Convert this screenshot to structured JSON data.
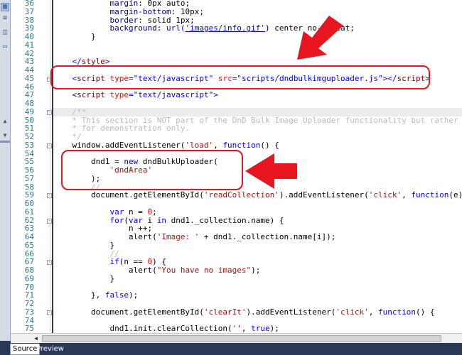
{
  "toolbar": {
    "icons": [
      "design-icon",
      "code-icon",
      "split-icon",
      "monitor-icon"
    ]
  },
  "gutter": {
    "line_numbers": [
      "36",
      "37",
      "38",
      "39",
      "40",
      "41",
      "42",
      "43",
      "44",
      "45",
      "46",
      "47",
      "48",
      "49",
      "50",
      "51",
      "52",
      "53",
      "54",
      "55",
      "56",
      "57",
      "58",
      "59",
      "60",
      "61",
      "62",
      "63",
      "64",
      "65",
      "66",
      "67",
      "68",
      "69",
      "70",
      "71",
      "72",
      "73",
      "74",
      "75"
    ]
  },
  "code": {
    "lines": [
      [
        {
          "c": "            margin",
          "k": "p"
        },
        {
          "c": ": 0px auto;"
        }
      ],
      [
        {
          "c": "            margin-bottom",
          "k": "p"
        },
        {
          "c": ": 10px;"
        }
      ],
      [
        {
          "c": "            border",
          "k": "p"
        },
        {
          "c": ": solid 1px;"
        }
      ],
      [
        {
          "c": "            background",
          "k": "p"
        },
        {
          "c": ": "
        },
        {
          "c": "url(",
          "k": "k"
        },
        {
          "c": "'images/info.gif'",
          "k": "u"
        },
        {
          "c": ") center no-repeat;"
        }
      ],
      [
        {
          "c": "        }"
        }
      ],
      [],
      [],
      [
        {
          "c": "    "
        },
        {
          "c": "</",
          "k": "k"
        },
        {
          "c": "style",
          "k": "t"
        },
        {
          "c": ">",
          "k": "k"
        }
      ],
      [],
      [
        {
          "c": "    "
        },
        {
          "c": "<",
          "k": "k"
        },
        {
          "c": "script",
          "k": "t"
        },
        {
          "c": " "
        },
        {
          "c": "type",
          "k": "a"
        },
        {
          "c": "=",
          "k": "k"
        },
        {
          "c": "\"text/javascript\"",
          "k": "k"
        },
        {
          "c": " "
        },
        {
          "c": "src",
          "k": "a"
        },
        {
          "c": "=",
          "k": "k"
        },
        {
          "c": "\"scripts/dndbulkimguploader.js\"",
          "k": "k"
        },
        {
          "c": "></",
          "k": "k"
        },
        {
          "c": "script",
          "k": "t"
        },
        {
          "c": ">",
          "k": "k"
        }
      ],
      [],
      [
        {
          "c": "    "
        },
        {
          "c": "<",
          "k": "k"
        },
        {
          "c": "script",
          "k": "t"
        },
        {
          "c": " "
        },
        {
          "c": "type",
          "k": "a"
        },
        {
          "c": "=",
          "k": "k"
        },
        {
          "c": "\"text/javascript\"",
          "k": "k"
        },
        {
          "c": ">",
          "k": "k"
        }
      ],
      [],
      [
        {
          "c": "    "
        },
        {
          "c": "/**",
          "k": "c"
        }
      ],
      [
        {
          "c": "    * This section is NOT part of the DnD Bulk Image Uploader functionality but rather",
          "k": "c"
        }
      ],
      [
        {
          "c": "    * for demonstration only.",
          "k": "c"
        }
      ],
      [
        {
          "c": "    */",
          "k": "c"
        }
      ],
      [
        {
          "c": "    window.addEventListener("
        },
        {
          "c": "'load'",
          "k": "s"
        },
        {
          "c": ", "
        },
        {
          "c": "function",
          "k": "k"
        },
        {
          "c": "() {"
        }
      ],
      [],
      [
        {
          "c": "        dnd1 = "
        },
        {
          "c": "new",
          "k": "k"
        },
        {
          "c": " dndBulkUploader("
        }
      ],
      [
        {
          "c": "            "
        },
        {
          "c": "'dndArea'",
          "k": "s"
        }
      ],
      [
        {
          "c": "        );"
        }
      ],
      [
        {
          "c": "        //",
          "k": "c"
        }
      ],
      [
        {
          "c": "        document.getElementById("
        },
        {
          "c": "'readCollection'",
          "k": "s"
        },
        {
          "c": ").addEventListener("
        },
        {
          "c": "'click'",
          "k": "s"
        },
        {
          "c": ", "
        },
        {
          "c": "function",
          "k": "k"
        },
        {
          "c": "(e) {"
        }
      ],
      [],
      [
        {
          "c": "            "
        },
        {
          "c": "var",
          "k": "k"
        },
        {
          "c": " n = "
        },
        {
          "c": "0",
          "k": "a"
        },
        {
          "c": ";"
        }
      ],
      [
        {
          "c": "            "
        },
        {
          "c": "for",
          "k": "k"
        },
        {
          "c": "("
        },
        {
          "c": "var",
          "k": "k"
        },
        {
          "c": " i "
        },
        {
          "c": "in",
          "k": "k"
        },
        {
          "c": " dnd1._collection.name) {"
        }
      ],
      [
        {
          "c": "                n ++;"
        }
      ],
      [
        {
          "c": "                alert("
        },
        {
          "c": "'Image: '",
          "k": "s"
        },
        {
          "c": " + dnd1._collection.name[i]);"
        }
      ],
      [
        {
          "c": "            }"
        }
      ],
      [
        {
          "c": "            //",
          "k": "c"
        }
      ],
      [
        {
          "c": "            "
        },
        {
          "c": "if",
          "k": "k"
        },
        {
          "c": "(n == "
        },
        {
          "c": "0",
          "k": "a"
        },
        {
          "c": ") {"
        }
      ],
      [
        {
          "c": "                alert("
        },
        {
          "c": "\"You have no images\"",
          "k": "s"
        },
        {
          "c": ");"
        }
      ],
      [
        {
          "c": "            }"
        }
      ],
      [],
      [
        {
          "c": "        }, "
        },
        {
          "c": "false",
          "k": "k"
        },
        {
          "c": ");"
        }
      ],
      [],
      [
        {
          "c": "        document.getElementById("
        },
        {
          "c": "'clearIt'",
          "k": "s"
        },
        {
          "c": ").addEventListener("
        },
        {
          "c": "'click'",
          "k": "s"
        },
        {
          "c": ", "
        },
        {
          "c": "function",
          "k": "k"
        },
        {
          "c": "() {"
        }
      ],
      [],
      [
        {
          "c": "            dnd1.init.clearCollection("
        },
        {
          "c": "''",
          "k": "s"
        },
        {
          "c": ", "
        },
        {
          "c": "true",
          "k": "k"
        },
        {
          "c": ");"
        }
      ]
    ]
  },
  "tabs": {
    "source": "Source",
    "preview": "Preview"
  },
  "colors": {
    "annotation": "#e8141e",
    "bottom_bar": "#293955"
  }
}
